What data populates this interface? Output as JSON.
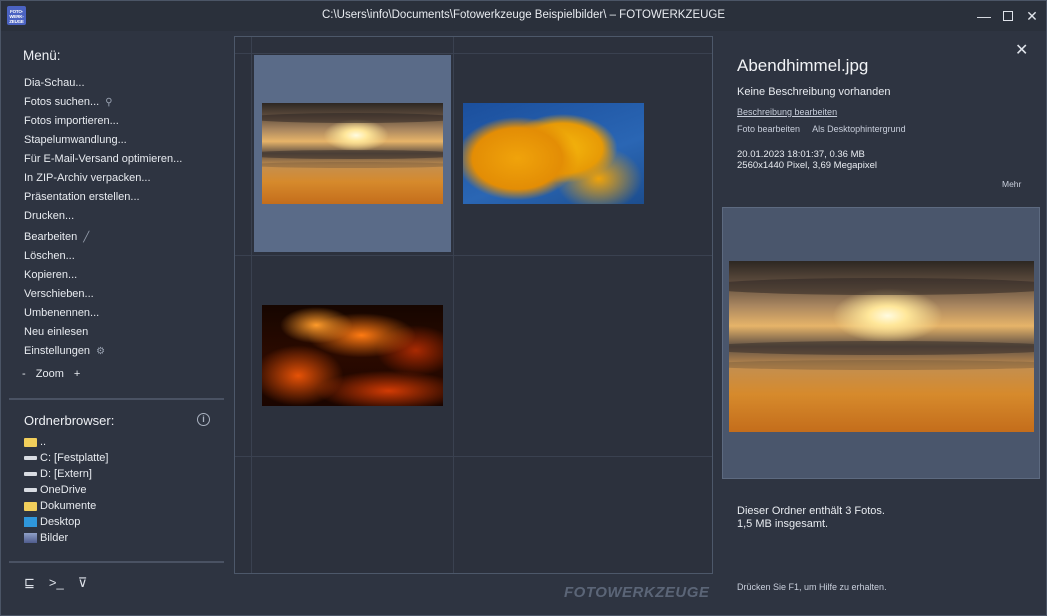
{
  "window": {
    "logo_text": "FOTO-WERK-ZEUGE",
    "title": "C:\\Users\\info\\Documents\\Fotowerkzeuge Beispielbilder\\ – FOTOWERKZEUGE",
    "minimize": "—",
    "close": "✕"
  },
  "sidebar": {
    "menu_heading": "Menü:",
    "menu_items": [
      "Dia-Schau...",
      "Fotos suchen...",
      "Fotos importieren...",
      "Stapelumwandlung...",
      "Für E-Mail-Versand optimieren...",
      "In ZIP-Archiv verpacken...",
      "Präsentation erstellen...",
      "Drucken...",
      "Bearbeiten",
      "Löschen...",
      "Kopieren...",
      "Verschieben...",
      "Umbenennen...",
      "Neu einlesen",
      "Einstellungen"
    ],
    "zoom": {
      "minus": "-",
      "label": "Zoom",
      "plus": "+"
    },
    "folder_heading": "Ordnerbrowser:",
    "folders": [
      {
        "label": "..",
        "icon": "folder-icon"
      },
      {
        "label": "C: [Festplatte]",
        "icon": "drive-icon"
      },
      {
        "label": "D: [Extern]",
        "icon": "drive-icon"
      },
      {
        "label": "OneDrive",
        "icon": "drive-icon"
      },
      {
        "label": "Dokumente",
        "icon": "folder-icon"
      },
      {
        "label": "Desktop",
        "icon": "desktop-icon"
      },
      {
        "label": "Bilder",
        "icon": "pictures-icon"
      }
    ],
    "tools": {
      "tree": "⊑",
      "console": ">_",
      "filter": "⊽"
    }
  },
  "grid": {
    "thumbnails": [
      "sunset",
      "autumn-tree",
      "embers"
    ],
    "selected_index": 0,
    "brand": "FOTOWERKZEUGE"
  },
  "details": {
    "close": "✕",
    "filename": "Abendhimmel.jpg",
    "description": "Keine Beschreibung vorhanden",
    "edit_description": "Beschreibung bearbeiten",
    "edit_photo": "Foto bearbeiten",
    "set_wallpaper": "Als Desktophintergrund",
    "date_size": "20.01.2023 18:01:37, 0.36 MB",
    "dimensions": "2560x1440 Pixel, 3,69 Megapixel",
    "more": "Mehr",
    "folder_summary_1": "Dieser Ordner enthält 3 Fotos.",
    "folder_summary_2": "1,5 MB insgesamt.",
    "help_hint": "Drücken Sie F1, um Hilfe zu erhalten."
  },
  "colors": {
    "background": "#2e3441",
    "selection": "#5a6b88",
    "text": "#e8ebf0"
  }
}
